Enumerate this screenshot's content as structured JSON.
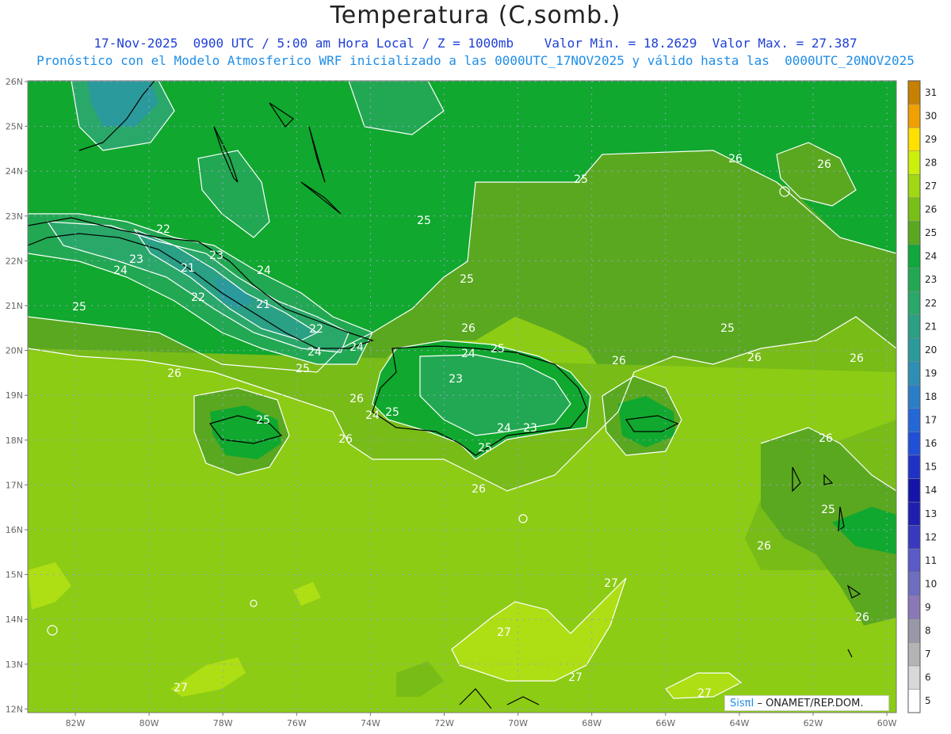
{
  "header": {
    "title": "Temperatura (C,somb.)",
    "line1": "17-Nov-2025  0900 UTC / 5:00 am Hora Local / Z = 1000mb    Valor Min. = 18.2629  Valor Max. = 27.387",
    "line2": "Pronóstico con el Modelo Atmosferico WRF inicializado a las 0000UTC_17NOV2025 y válido hasta las  0000UTC_20NOV2025"
  },
  "axes": {
    "lat_labels": [
      "26N",
      "25N",
      "24N",
      "23N",
      "22N",
      "21N",
      "20N",
      "19N",
      "18N",
      "17N",
      "16N",
      "15N",
      "14N",
      "13N",
      "12N"
    ],
    "lon_labels": [
      "82W",
      "80W",
      "78W",
      "76W",
      "74W",
      "72W",
      "70W",
      "68W",
      "66W",
      "64W",
      "62W",
      "60W"
    ]
  },
  "isotherm_labels": [
    "22",
    "23",
    "24",
    "21",
    "21",
    "22",
    "24",
    "25",
    "23",
    "22",
    "25",
    "26",
    "26",
    "25",
    "24",
    "25",
    "26",
    "24",
    "25",
    "23",
    "24",
    "23",
    "25",
    "26",
    "26",
    "24",
    "25",
    "25",
    "25",
    "26",
    "26",
    "25",
    "26",
    "26",
    "26",
    "26",
    "25",
    "26",
    "26",
    "27",
    "27",
    "27",
    "27",
    "27",
    "24"
  ],
  "colorbar": {
    "levels": [
      "5",
      "6",
      "7",
      "8",
      "9",
      "10",
      "11",
      "12",
      "13",
      "14",
      "15",
      "16",
      "17",
      "18",
      "19",
      "20",
      "21",
      "22",
      "23",
      "24",
      "25",
      "26",
      "27",
      "28",
      "29",
      "30",
      "31"
    ],
    "colors": [
      "#ffffff",
      "#d8d8d8",
      "#b4b4b4",
      "#9898a8",
      "#8a78b8",
      "#6e6ec0",
      "#5a5ac8",
      "#3838c0",
      "#1e1eb0",
      "#1414a8",
      "#1e32c8",
      "#2050d8",
      "#2468d8",
      "#2a7ec8",
      "#2e8eb4",
      "#2a9a9c",
      "#2aa084",
      "#2aa86a",
      "#22a852",
      "#0ea83c",
      "#58a820",
      "#78c018",
      "#a0d814",
      "#ccf00c",
      "#ffe000",
      "#f0a000",
      "#c88000"
    ]
  },
  "credit": {
    "sis": "SisπI",
    "text": " – ONAMET/REP.DOM."
  },
  "colors": {
    "land_outline": "#000000",
    "isotherm": "#ffffff",
    "grid": "#9aa0c8"
  }
}
